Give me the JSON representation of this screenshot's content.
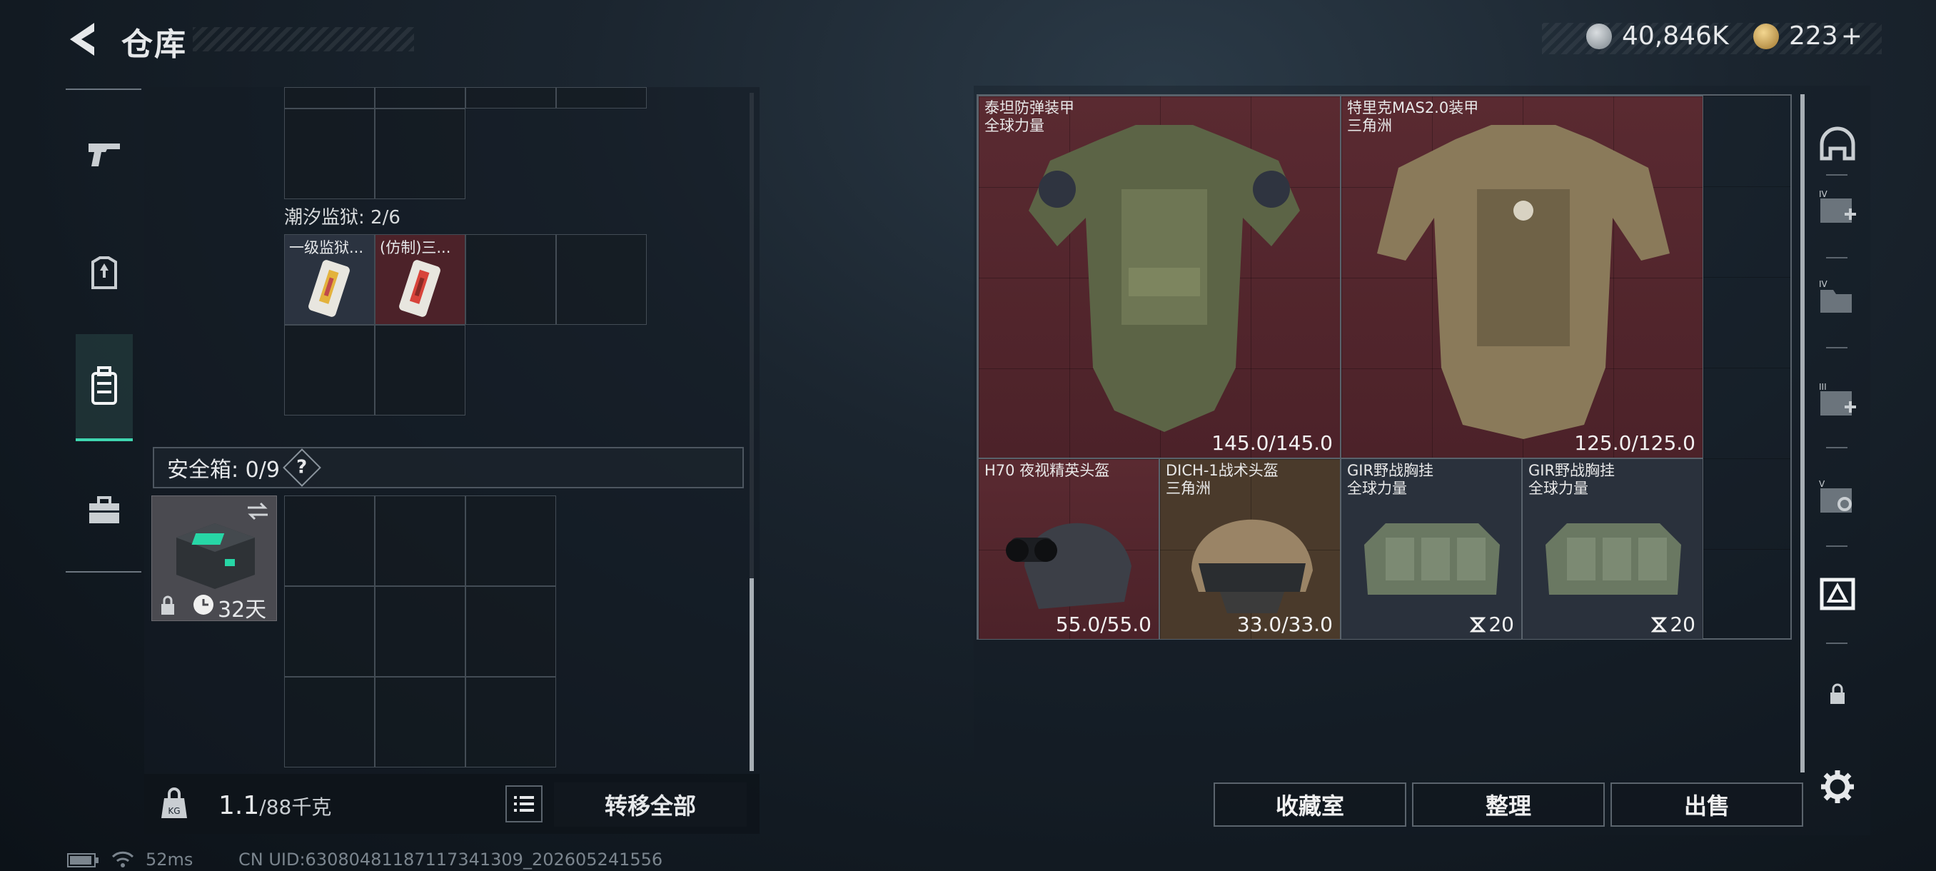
{
  "header": {
    "title": "仓库",
    "currency1_value": "40,846K",
    "currency2_value": "223",
    "currency2_add": "+"
  },
  "left_panel": {
    "tidal_prison_label": "潮汐监狱: 2/6",
    "tidal_items": [
      {
        "name": "一级监狱..."
      },
      {
        "name": "(仿制)三..."
      }
    ],
    "safe_box_label": "安全箱: 0/9",
    "safe_help": "?",
    "safe_item_days": "32天",
    "weight_current": "1.1",
    "weight_max": "/88千克",
    "transfer_all": "转移全部"
  },
  "inventory": {
    "items": [
      {
        "name": "泰坦防弹装甲",
        "sub": "全球力量",
        "durability": "145.0/145.0"
      },
      {
        "name": "特里克MAS2.0装甲",
        "sub": "三角洲",
        "durability": "125.0/125.0"
      },
      {
        "name": "H70 夜视精英头盔",
        "sub": "",
        "durability": "55.0/55.0"
      },
      {
        "name": "DICH-1战术头盔",
        "sub": "三角洲",
        "durability": "33.0/33.0"
      },
      {
        "name": "GIR野战胸挂",
        "sub": "全球力量",
        "capacity": "20"
      },
      {
        "name": "GIR野战胸挂",
        "sub": "全球力量",
        "capacity": "20"
      }
    ]
  },
  "buttons": {
    "collection": "收藏室",
    "organize": "整理",
    "sell": "出售"
  },
  "status": {
    "ping": "52ms",
    "uid": "CN UID:63080481187117341309_202605241556"
  },
  "colors": {
    "accent": "#3fd6b0",
    "red_slot": "#5a2a31",
    "gray_slot": "#2a313c"
  }
}
